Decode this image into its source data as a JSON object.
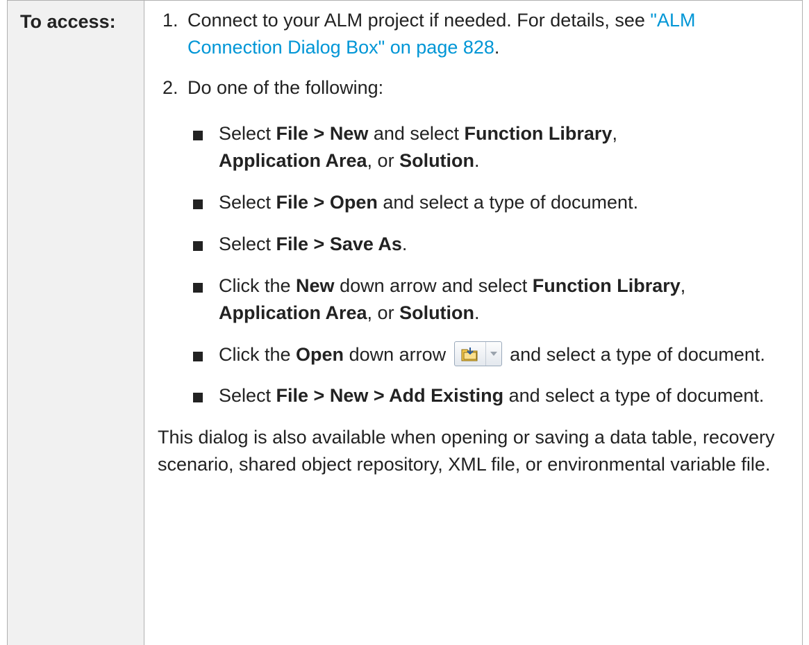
{
  "label": "To access:",
  "steps": [
    {
      "num": "1.",
      "text_before": "Connect to your ALM project if needed. For details, see ",
      "link": "\"ALM Connection Dialog Box\" on page 828",
      "text_after": "."
    },
    {
      "num": "2.",
      "text": "Do one of the following:"
    }
  ],
  "bullets": [
    {
      "p1": "Select ",
      "b1": "File > New",
      "p2": " and select ",
      "b2": "Function Library",
      "p3": ", ",
      "b3": "Application Area",
      "p4": ", or ",
      "b4": "Solution",
      "p5": "."
    },
    {
      "p1": "Select ",
      "b1": "File > Open",
      "p2": " and select a type of document."
    },
    {
      "p1": "Select ",
      "b1": "File > Save As",
      "p2": "."
    },
    {
      "p1": "Click the ",
      "b1": "New",
      "p2": " down arrow and select ",
      "b2": "Function Library",
      "p3": ", ",
      "b3": "Application Area",
      "p4": ", or ",
      "b4": "Solution",
      "p5": "."
    },
    {
      "p1": "Click the ",
      "b1": "Open",
      "p2": " down arrow ",
      "icon": "open-folder-dropdown-icon",
      "p3": " and select a type of document."
    },
    {
      "p1": "Select ",
      "b1": "File > New > Add Existing",
      "p2": " and select a type of document."
    }
  ],
  "note": "This dialog is also available when opening or saving a data table, recovery scenario, shared object repository, XML file, or environmental variable file.",
  "colors": {
    "link": "#0096d6",
    "label_bg": "#f1f1f1",
    "border": "#b0b0b0"
  }
}
